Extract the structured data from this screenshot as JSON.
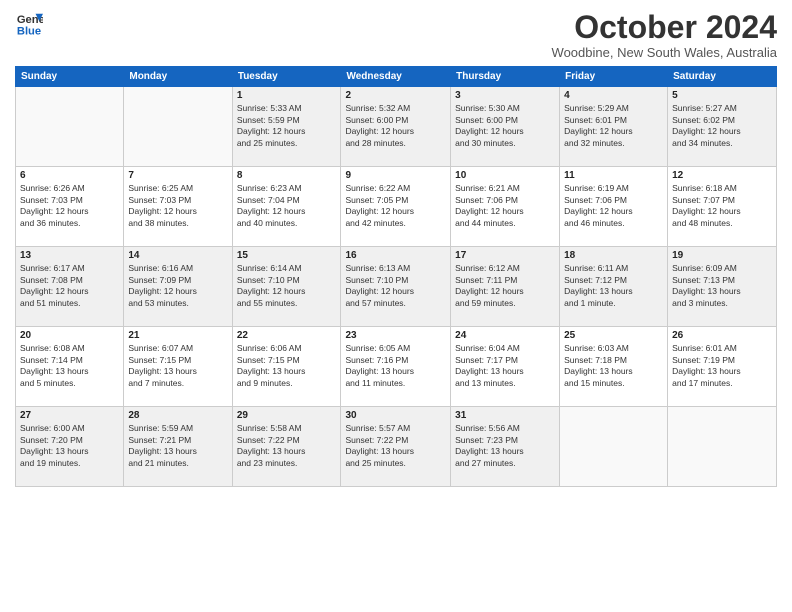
{
  "logo": {
    "line1": "General",
    "line2": "Blue"
  },
  "title": "October 2024",
  "subtitle": "Woodbine, New South Wales, Australia",
  "days_of_week": [
    "Sunday",
    "Monday",
    "Tuesday",
    "Wednesday",
    "Thursday",
    "Friday",
    "Saturday"
  ],
  "weeks": [
    [
      {
        "day": "",
        "info": ""
      },
      {
        "day": "",
        "info": ""
      },
      {
        "day": "1",
        "info": "Sunrise: 5:33 AM\nSunset: 5:59 PM\nDaylight: 12 hours\nand 25 minutes."
      },
      {
        "day": "2",
        "info": "Sunrise: 5:32 AM\nSunset: 6:00 PM\nDaylight: 12 hours\nand 28 minutes."
      },
      {
        "day": "3",
        "info": "Sunrise: 5:30 AM\nSunset: 6:00 PM\nDaylight: 12 hours\nand 30 minutes."
      },
      {
        "day": "4",
        "info": "Sunrise: 5:29 AM\nSunset: 6:01 PM\nDaylight: 12 hours\nand 32 minutes."
      },
      {
        "day": "5",
        "info": "Sunrise: 5:27 AM\nSunset: 6:02 PM\nDaylight: 12 hours\nand 34 minutes."
      }
    ],
    [
      {
        "day": "6",
        "info": "Sunrise: 6:26 AM\nSunset: 7:03 PM\nDaylight: 12 hours\nand 36 minutes."
      },
      {
        "day": "7",
        "info": "Sunrise: 6:25 AM\nSunset: 7:03 PM\nDaylight: 12 hours\nand 38 minutes."
      },
      {
        "day": "8",
        "info": "Sunrise: 6:23 AM\nSunset: 7:04 PM\nDaylight: 12 hours\nand 40 minutes."
      },
      {
        "day": "9",
        "info": "Sunrise: 6:22 AM\nSunset: 7:05 PM\nDaylight: 12 hours\nand 42 minutes."
      },
      {
        "day": "10",
        "info": "Sunrise: 6:21 AM\nSunset: 7:06 PM\nDaylight: 12 hours\nand 44 minutes."
      },
      {
        "day": "11",
        "info": "Sunrise: 6:19 AM\nSunset: 7:06 PM\nDaylight: 12 hours\nand 46 minutes."
      },
      {
        "day": "12",
        "info": "Sunrise: 6:18 AM\nSunset: 7:07 PM\nDaylight: 12 hours\nand 48 minutes."
      }
    ],
    [
      {
        "day": "13",
        "info": "Sunrise: 6:17 AM\nSunset: 7:08 PM\nDaylight: 12 hours\nand 51 minutes."
      },
      {
        "day": "14",
        "info": "Sunrise: 6:16 AM\nSunset: 7:09 PM\nDaylight: 12 hours\nand 53 minutes."
      },
      {
        "day": "15",
        "info": "Sunrise: 6:14 AM\nSunset: 7:10 PM\nDaylight: 12 hours\nand 55 minutes."
      },
      {
        "day": "16",
        "info": "Sunrise: 6:13 AM\nSunset: 7:10 PM\nDaylight: 12 hours\nand 57 minutes."
      },
      {
        "day": "17",
        "info": "Sunrise: 6:12 AM\nSunset: 7:11 PM\nDaylight: 12 hours\nand 59 minutes."
      },
      {
        "day": "18",
        "info": "Sunrise: 6:11 AM\nSunset: 7:12 PM\nDaylight: 13 hours\nand 1 minute."
      },
      {
        "day": "19",
        "info": "Sunrise: 6:09 AM\nSunset: 7:13 PM\nDaylight: 13 hours\nand 3 minutes."
      }
    ],
    [
      {
        "day": "20",
        "info": "Sunrise: 6:08 AM\nSunset: 7:14 PM\nDaylight: 13 hours\nand 5 minutes."
      },
      {
        "day": "21",
        "info": "Sunrise: 6:07 AM\nSunset: 7:15 PM\nDaylight: 13 hours\nand 7 minutes."
      },
      {
        "day": "22",
        "info": "Sunrise: 6:06 AM\nSunset: 7:15 PM\nDaylight: 13 hours\nand 9 minutes."
      },
      {
        "day": "23",
        "info": "Sunrise: 6:05 AM\nSunset: 7:16 PM\nDaylight: 13 hours\nand 11 minutes."
      },
      {
        "day": "24",
        "info": "Sunrise: 6:04 AM\nSunset: 7:17 PM\nDaylight: 13 hours\nand 13 minutes."
      },
      {
        "day": "25",
        "info": "Sunrise: 6:03 AM\nSunset: 7:18 PM\nDaylight: 13 hours\nand 15 minutes."
      },
      {
        "day": "26",
        "info": "Sunrise: 6:01 AM\nSunset: 7:19 PM\nDaylight: 13 hours\nand 17 minutes."
      }
    ],
    [
      {
        "day": "27",
        "info": "Sunrise: 6:00 AM\nSunset: 7:20 PM\nDaylight: 13 hours\nand 19 minutes."
      },
      {
        "day": "28",
        "info": "Sunrise: 5:59 AM\nSunset: 7:21 PM\nDaylight: 13 hours\nand 21 minutes."
      },
      {
        "day": "29",
        "info": "Sunrise: 5:58 AM\nSunset: 7:22 PM\nDaylight: 13 hours\nand 23 minutes."
      },
      {
        "day": "30",
        "info": "Sunrise: 5:57 AM\nSunset: 7:22 PM\nDaylight: 13 hours\nand 25 minutes."
      },
      {
        "day": "31",
        "info": "Sunrise: 5:56 AM\nSunset: 7:23 PM\nDaylight: 13 hours\nand 27 minutes."
      },
      {
        "day": "",
        "info": ""
      },
      {
        "day": "",
        "info": ""
      }
    ]
  ]
}
